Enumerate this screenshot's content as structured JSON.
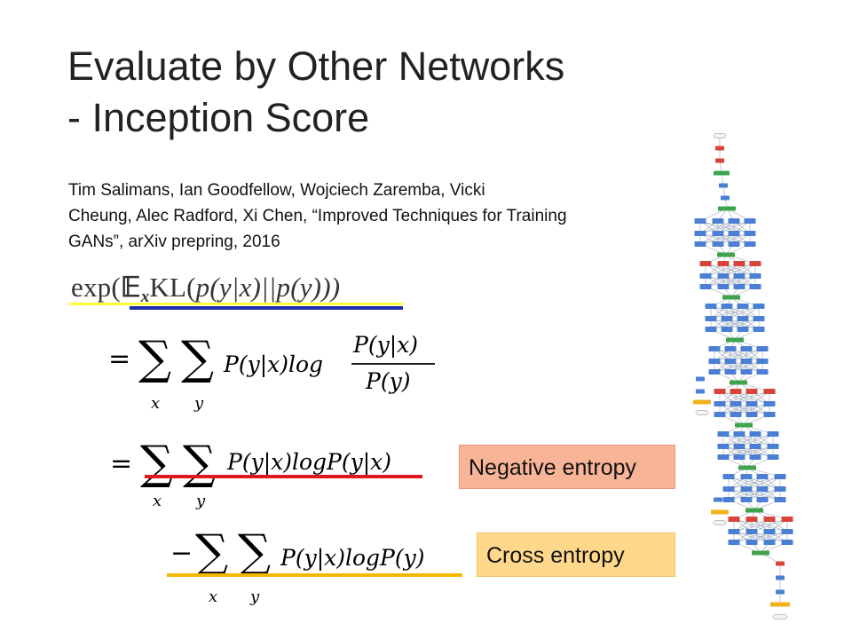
{
  "slide": {
    "title_line1": "Evaluate by Other Networks",
    "title_line2": "- Inception Score",
    "citation_line1": "Tim Salimans, Ian Goodfellow, Wojciech Zaremba, Vicki",
    "citation_line2": "Cheung, Alec Radford, Xi Chen, “Improved Techniques for Training",
    "citation_line3": "GANs”, arXiv prepring, 2016"
  },
  "formula": {
    "kl_exp": "exp(",
    "kl_E": "𝔼",
    "kl_x_sub": "x",
    "kl_KL": "KL(",
    "kl_body": "p(y|x)||p(y)))",
    "eq1_equals": "=",
    "sum": "∑",
    "sub_x": "x",
    "sub_y": "y",
    "eq1_term": "P(y|x)log",
    "eq1_num": "P(y|x)",
    "eq1_den": "P(y)",
    "eq2_equals": "=",
    "eq2_term": "P(y|x)logP(y|x)",
    "eq3_minus": "−",
    "eq3_term": "P(y|x)logP(y)"
  },
  "labels": {
    "negative_entropy": "Negative entropy",
    "cross_entropy": "Cross entropy"
  },
  "colors": {
    "yellow_line": "#ffff33",
    "blue_line": "#1f2ea8",
    "red_line": "#e0161e",
    "orange_line": "#f5b800",
    "negative_entropy_fill": "#f8b497",
    "cross_entropy_fill": "#ffd88c"
  }
}
